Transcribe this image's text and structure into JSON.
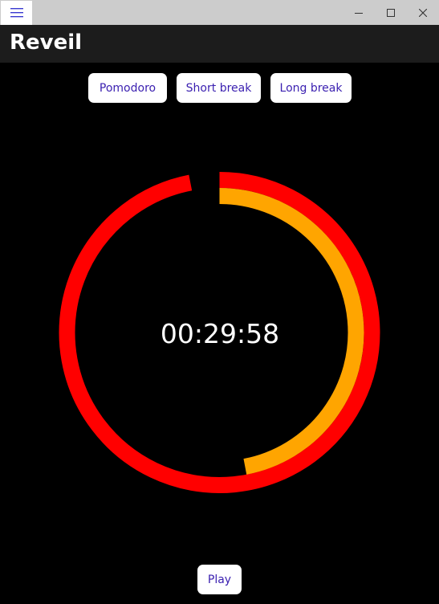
{
  "window": {
    "title": "Reveil",
    "controls": [
      "minimize-icon",
      "maximize-icon",
      "close-icon"
    ]
  },
  "modes": [
    {
      "label": "Pomodoro"
    },
    {
      "label": "Short break"
    },
    {
      "label": "Long break"
    }
  ],
  "timer": {
    "display": "00:29:58"
  },
  "ring": {
    "outer_color": "#ff0000",
    "progress_color": "#ffa500",
    "progress_fraction": 0.47
  },
  "controls": {
    "play_label": "Play"
  }
}
